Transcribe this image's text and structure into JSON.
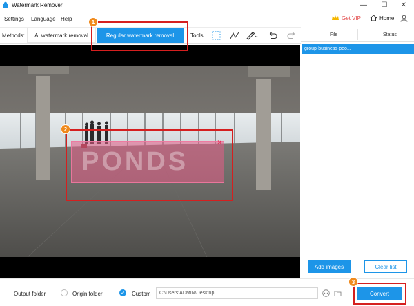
{
  "window": {
    "title": "Watermark Remover",
    "minimize": "—",
    "maximize": "☐",
    "close": "✕"
  },
  "menu": {
    "settings": "Settings",
    "language": "Language",
    "help": "Help",
    "vip": "Get VIP",
    "home": "Home"
  },
  "toolbar": {
    "methods_label": "Methods:",
    "ai_tab": "AI watermark removal",
    "regular_tab": "Regular watermark removal",
    "tools_label": "Tools",
    "tools": [
      "rectangle-select-icon",
      "polygon-lasso-icon",
      "brush-icon",
      "undo-icon",
      "redo-icon"
    ]
  },
  "file_panel": {
    "col_file": "File",
    "col_status": "Status",
    "files": [
      {
        "name": "group-business-peo...",
        "status": ""
      }
    ],
    "add_images": "Add images",
    "clear_list": "Clear list"
  },
  "canvas": {
    "watermark_text": "PONDS",
    "selection_close": "✕"
  },
  "bottom": {
    "output_folder_label": "Output folder",
    "origin_folder": "Origin folder",
    "custom": "Custom",
    "path": "C:\\Users\\ADMIN\\Desktop",
    "convert": "Convert",
    "selected_option": "Custom"
  },
  "annotations": {
    "step1": "1",
    "step2": "2",
    "step3": "3"
  },
  "colors": {
    "accent": "#1d95e8",
    "annotation": "#d51f1f",
    "badge": "#f08a1d",
    "selection": "#e05c86"
  }
}
